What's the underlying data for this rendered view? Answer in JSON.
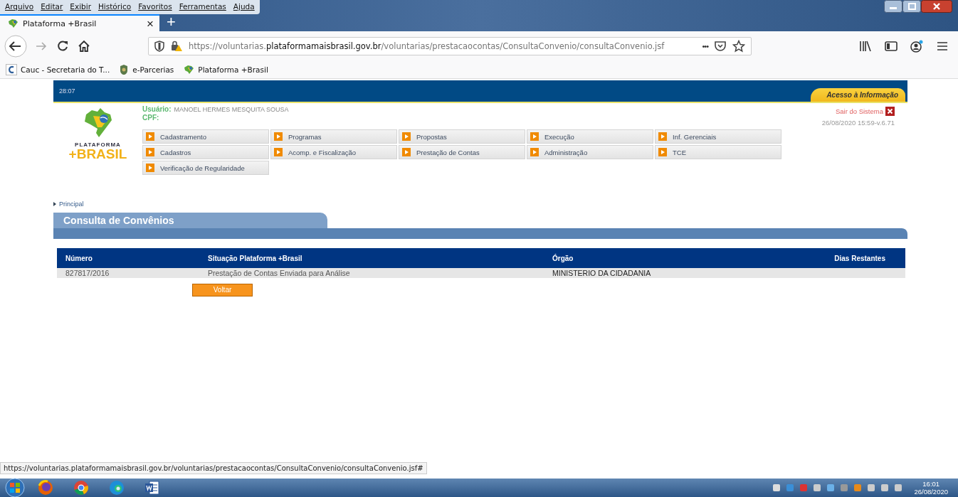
{
  "browser": {
    "menu": [
      "Arquivo",
      "Editar",
      "Exibir",
      "Histórico",
      "Favoritos",
      "Ferramentas",
      "Ajuda"
    ],
    "tabs": [
      {
        "title": "Plataforma +Brasil",
        "selected": true,
        "close": "×"
      }
    ],
    "new_tab": "+",
    "url": "https://voluntarias.**plataformamaisbrasil.gov.br**/voluntarias/prestacaocontas/ConsultaConvenio/consultaConvenio.jsf",
    "page_actions": "•••",
    "bookmarks": [
      {
        "kind": "letter",
        "label": "Cauc - Secretaria do T..."
      },
      {
        "kind": "seal",
        "label": "e-Parcerias"
      },
      {
        "kind": "map",
        "label": "Plataforma +Brasil"
      }
    ],
    "status_url": "https://voluntarias.plataformamaisbrasil.gov.br/voluntarias/prestacaocontas/ConsultaConvenio/consultaConvenio.jsf#"
  },
  "header": {
    "timer": "28:07",
    "access_link": "Acesso à Informação"
  },
  "logo": {
    "line1": "PLATAFORMA",
    "line2": "+BRASIL"
  },
  "user": {
    "user_label": "Usuário:",
    "user_name": "MANOEL HERMES MESQUITA SOUSA",
    "cpf_label": "CPF:"
  },
  "logout": "Sair do Sistema",
  "version": "26/08/2020 15:59-v.6.71",
  "menu_items": [
    {
      "label": "Cadastramento"
    },
    {
      "label": "Programas"
    },
    {
      "label": "Propostas"
    },
    {
      "label": "Execução"
    },
    {
      "label": "Inf. Gerenciais"
    },
    {
      "label": "Cadastros"
    },
    {
      "label": "Acomp. e Fiscalização"
    },
    {
      "label": "Prestação de Contas"
    },
    {
      "label": "Administração"
    },
    {
      "label": "TCE"
    },
    {
      "label": "Verificação de Regularidade"
    }
  ],
  "breadcrumb": "Principal",
  "panel_title": "Consulta de Convênios",
  "table": {
    "columns": [
      "Número",
      "Situação Plataforma +Brasil",
      "Órgão",
      "Dias Restantes"
    ],
    "rows": [
      [
        "827817/2016",
        "Prestação de Contas Enviada para Análise",
        "MINISTERIO DA CIDADANIA",
        ""
      ]
    ]
  },
  "back_button": "Voltar",
  "taskbar": {
    "apps": [
      {
        "kind": "firefox"
      },
      {
        "kind": "chrome"
      },
      {
        "kind": "edge"
      },
      {
        "kind": "word"
      }
    ],
    "time": "16:01",
    "date": "26/08/2020"
  }
}
